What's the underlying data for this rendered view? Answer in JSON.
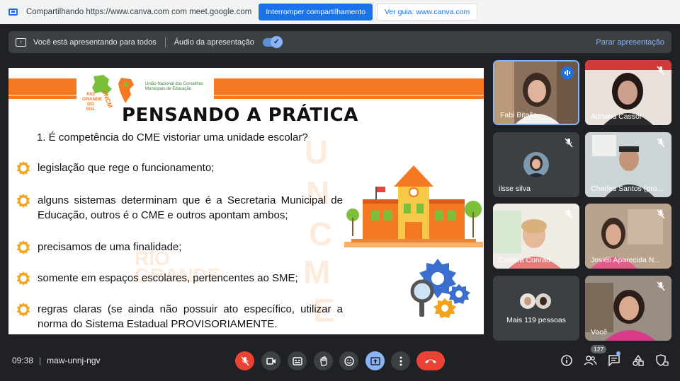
{
  "sharebar": {
    "message": "Compartilhando https://www.canva.com com meet.google.com",
    "stop_button": "Interromper compartilhamento",
    "guide_button": "Ver guia: www.canva.com"
  },
  "presbar": {
    "presenting_text": "Você está apresentando para todos",
    "audio_label": "Áudio da apresentação",
    "audio_enabled": true,
    "stop_label": "Parar apresentação"
  },
  "slide": {
    "logo": {
      "acronym": "UNCME",
      "state": "RIO GRANDE DO SUL",
      "org_name": "União Nacional dos Conselhos Municipais de Educação"
    },
    "title": "PENSANDO A PRÁTICA",
    "question": "1. É competência do CME vistoriar uma unidade escolar?",
    "items": [
      "legislação que rege o funcionamento;",
      "alguns sistemas determinam que é a Secretaria Municipal de Educação, outros é o CME e outros apontam ambos;",
      "precisamos de uma finalidade;",
      "somente em espaços escolares, pertencentes ao SME;",
      "regras claras (se ainda não possuir ato específico, utilizar a norma do Sistema Estadual PROVISORIAMENTE."
    ],
    "watermark_letters": [
      "U",
      "N",
      "C",
      "M",
      "E"
    ],
    "watermark_words": [
      "RIO",
      "GRANDE"
    ]
  },
  "participants": [
    {
      "name": "Fabi Bitello",
      "muted": false,
      "speaking": true
    },
    {
      "name": "Adriana Cassol",
      "muted": true
    },
    {
      "name": "ilsse silva",
      "muted": true
    },
    {
      "name": "Charles Santos (pro...",
      "muted": true
    },
    {
      "name": "Cristina Conrad",
      "muted": true
    },
    {
      "name": "Josiéli Aparecida N...",
      "muted": true
    },
    {
      "name": "Mais 119 pessoas"
    },
    {
      "name": "Você",
      "muted": true
    }
  ],
  "bottombar": {
    "time": "09:38",
    "meeting_code": "maw-unnj-ngv",
    "participant_count": "127",
    "icons": [
      "mic-off-icon",
      "camera-icon",
      "captions-icon",
      "raise-hand-icon",
      "emoji-icon",
      "present-icon",
      "more-icon",
      "hangup-icon",
      "info-icon",
      "people-icon",
      "chat-icon",
      "activities-icon",
      "host-controls-icon"
    ]
  },
  "colors": {
    "accent_orange": "#f47920",
    "meet_blue": "#1a73e8",
    "meet_red": "#ea4335",
    "meet_bg": "#202124"
  }
}
